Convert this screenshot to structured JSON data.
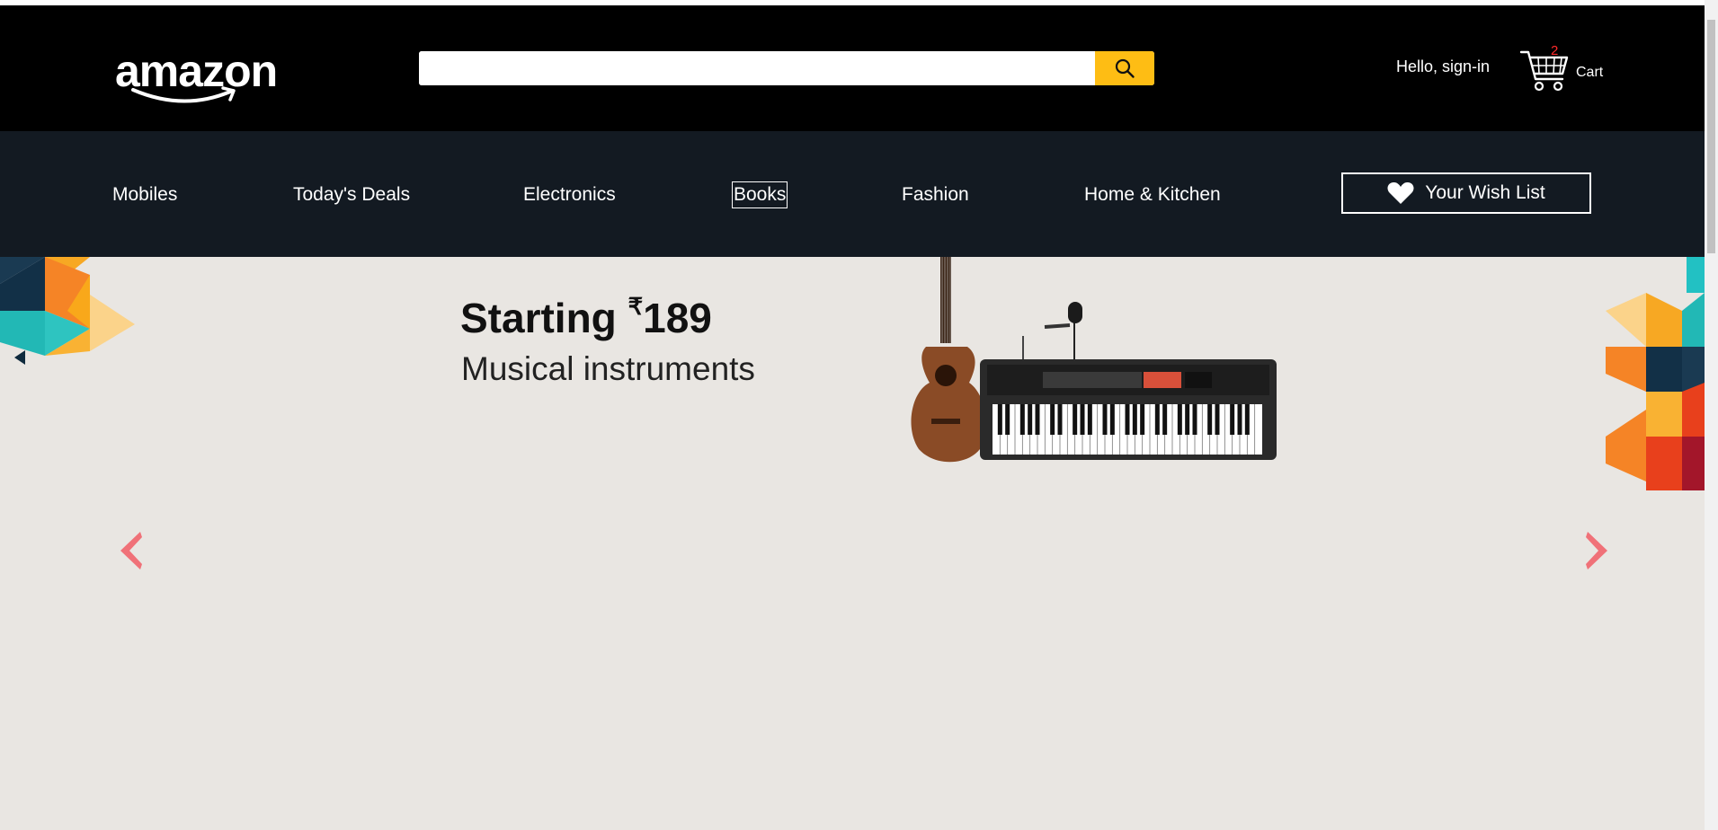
{
  "header": {
    "logo_text": "amazon",
    "search": {
      "placeholder": "",
      "value": ""
    },
    "signin_label": "Hello, sign-in",
    "cart": {
      "count": "2",
      "label": "Cart"
    }
  },
  "nav": {
    "items": [
      {
        "label": "Mobiles"
      },
      {
        "label": "Today's Deals"
      },
      {
        "label": "Electronics"
      },
      {
        "label": "Books",
        "focused": true
      },
      {
        "label": "Fashion"
      },
      {
        "label": "Home & Kitchen"
      }
    ],
    "wishlist_label": "Your Wish List"
  },
  "banner": {
    "headline_prefix": "Starting ",
    "currency": "₹",
    "price": "189",
    "subline": "Musical instruments"
  },
  "colors": {
    "header_bg": "#000000",
    "nav_bg": "#131a22",
    "search_button": "#febd14",
    "banner_bg": "#e9e6e2",
    "carousel_arrow": "#f07178",
    "cart_count": "#ff2a2a"
  },
  "icons": [
    "amazon-smile-logo",
    "search-icon",
    "cart-icon",
    "heart-icon",
    "chevron-left-icon",
    "chevron-right-icon",
    "guitar-image",
    "keyboard-image",
    "microphone-image"
  ]
}
